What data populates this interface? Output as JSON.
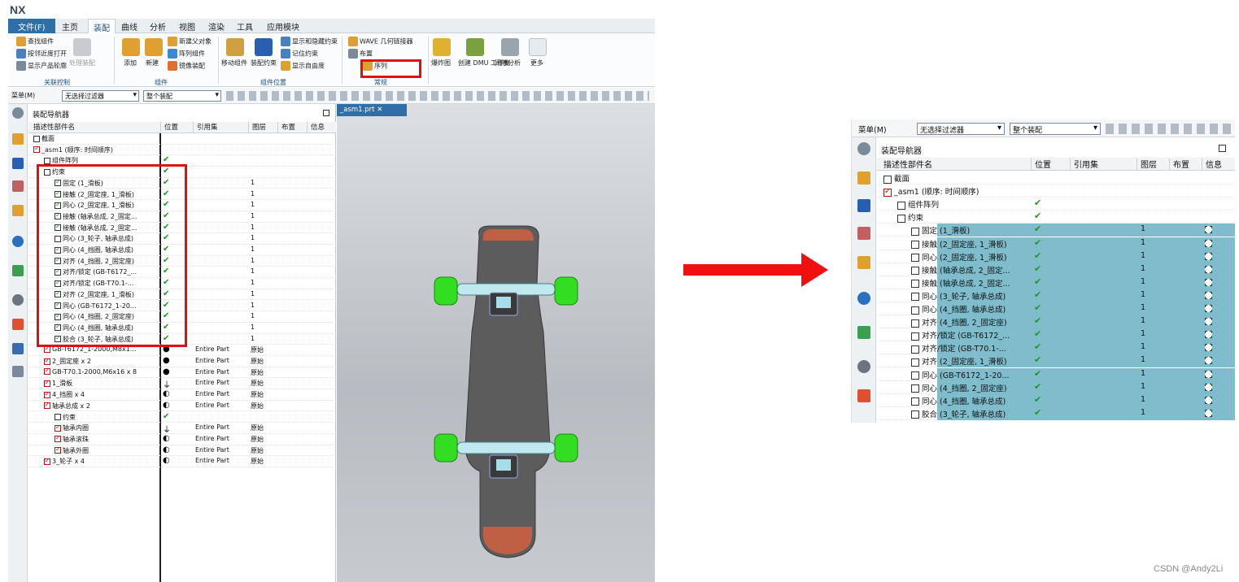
{
  "app": {
    "logo": "NX",
    "file_tab": "文件(F)"
  },
  "menu_tabs": [
    "主页",
    "装配",
    "曲线",
    "分析",
    "视图",
    "渲染",
    "工具",
    "应用模块"
  ],
  "ribbon": {
    "assoc": {
      "find": "查找组件",
      "open_near": "按邻近度打开",
      "show_contour": "显示产品轮廓",
      "process": "处理装配",
      "group": "关联控制"
    },
    "component": {
      "add": "添加",
      "new": "新建",
      "new_parent": "新建父对象",
      "array": "阵列组件",
      "mirror": "镜像装配",
      "group": "组件"
    },
    "position": {
      "move": "移动组件",
      "constraint": "装配约束",
      "show_hide": "显示和隐藏约束",
      "remember": "记住约束",
      "show_dof": "显示自由度",
      "group": "组件位置"
    },
    "general": {
      "wave": "WAVE 几何链接器",
      "layout": "布置",
      "sequence": "序列",
      "group": "常规"
    },
    "more": {
      "explode": "爆炸图",
      "dmu": "创建 DMU 工作集",
      "clearance": "间隙分析",
      "more": "更多"
    }
  },
  "toolbar": {
    "menu": "菜单(M)",
    "filter": "无选择过滤器",
    "scope": "整个装配"
  },
  "navigator": {
    "title": "装配导航器",
    "columns": [
      "描述性部件名",
      "位置",
      "引用集",
      "图层",
      "布置",
      "信息"
    ],
    "rows": [
      {
        "indent": 0,
        "label": "截面",
        "pos": "",
        "ref": "",
        "layer": ""
      },
      {
        "indent": 0,
        "label": "_asm1 (顺序: 时间顺序)",
        "pos": "",
        "ref": "",
        "layer": ""
      },
      {
        "indent": 1,
        "label": "组件阵列",
        "pos": "✔",
        "ref": "",
        "layer": ""
      },
      {
        "indent": 1,
        "label": "约束",
        "pos": "✔",
        "ref": "",
        "layer": ""
      },
      {
        "indent": 2,
        "label": "固定 (1_滑板)",
        "pos": "✔",
        "ref": "",
        "layer": "1"
      },
      {
        "indent": 2,
        "label": "接触 (2_固定座, 1_滑板)",
        "pos": "✔",
        "ref": "",
        "layer": "1"
      },
      {
        "indent": 2,
        "label": "同心 (2_固定座, 1_滑板)",
        "pos": "✔",
        "ref": "",
        "layer": "1"
      },
      {
        "indent": 2,
        "label": "接触 (轴承总成, 2_固定...",
        "pos": "✔",
        "ref": "",
        "layer": "1"
      },
      {
        "indent": 2,
        "label": "接触 (轴承总成, 2_固定...",
        "pos": "✔",
        "ref": "",
        "layer": "1"
      },
      {
        "indent": 2,
        "label": "同心 (3_轮子, 轴承总成)",
        "pos": "✔",
        "ref": "",
        "layer": "1"
      },
      {
        "indent": 2,
        "label": "同心 (4_挡圈, 轴承总成)",
        "pos": "✔",
        "ref": "",
        "layer": "1"
      },
      {
        "indent": 2,
        "label": "对齐 (4_挡圈, 2_固定座)",
        "pos": "✔",
        "ref": "",
        "layer": "1"
      },
      {
        "indent": 2,
        "label": "对齐/锁定 (GB-T6172_...",
        "pos": "✔",
        "ref": "",
        "layer": "1"
      },
      {
        "indent": 2,
        "label": "对齐/锁定 (GB-T70.1-...",
        "pos": "✔",
        "ref": "",
        "layer": "1"
      },
      {
        "indent": 2,
        "label": "对齐 (2_固定座, 1_滑板)",
        "pos": "✔",
        "ref": "",
        "layer": "1"
      },
      {
        "indent": 2,
        "label": "同心 (GB-T6172_1-20...",
        "pos": "✔",
        "ref": "",
        "layer": "1"
      },
      {
        "indent": 2,
        "label": "同心 (4_挡圈, 2_固定座)",
        "pos": "✔",
        "ref": "",
        "layer": "1"
      },
      {
        "indent": 2,
        "label": "同心 (4_挡圈, 轴承总成)",
        "pos": "✔",
        "ref": "",
        "layer": "1"
      },
      {
        "indent": 2,
        "label": "胶合 (3_轮子, 轴承总成)",
        "pos": "✔",
        "ref": "",
        "layer": "1"
      },
      {
        "indent": 1,
        "label": "GB-T6172_1-2000,M8x1...",
        "pos": "●",
        "ref": "Entire Part",
        "layer": "原始"
      },
      {
        "indent": 1,
        "label": "2_固定座 x 2",
        "pos": "●",
        "ref": "Entire Part",
        "layer": "原始"
      },
      {
        "indent": 1,
        "label": "GB-T70.1-2000,M6x16 x 8",
        "pos": "●",
        "ref": "Entire Part",
        "layer": "原始"
      },
      {
        "indent": 1,
        "label": "1_滑板",
        "pos": "⏚",
        "ref": "Entire Part",
        "layer": "原始"
      },
      {
        "indent": 1,
        "label": "4_挡圈 x 4",
        "pos": "◐",
        "ref": "Entire Part",
        "layer": "原始"
      },
      {
        "indent": 1,
        "label": "轴承总成 x 2",
        "pos": "◐",
        "ref": "Entire Part",
        "layer": "原始"
      },
      {
        "indent": 2,
        "label": "约束",
        "pos": "✔",
        "ref": "",
        "layer": ""
      },
      {
        "indent": 2,
        "label": "轴承内圈",
        "pos": "⏚",
        "ref": "Entire Part",
        "layer": "原始"
      },
      {
        "indent": 2,
        "label": "轴承滚珠",
        "pos": "◐",
        "ref": "Entire Part",
        "layer": "原始"
      },
      {
        "indent": 2,
        "label": "轴承外圈",
        "pos": "◐",
        "ref": "Entire Part",
        "layer": "原始"
      },
      {
        "indent": 1,
        "label": "3_轮子 x 4",
        "pos": "◐",
        "ref": "Entire Part",
        "layer": "原始"
      }
    ]
  },
  "viewport": {
    "tab": "_asm1.prt"
  },
  "right": {
    "toolbar": {
      "menu": "菜单(M)",
      "filter": "无选择过滤器",
      "scope": "整个装配"
    },
    "title": "装配导航器",
    "columns": [
      "描述性部件名",
      "位置",
      "引用集",
      "图层",
      "布置",
      "信息"
    ],
    "rows": [
      {
        "indent": 0,
        "label": "截面",
        "pos": "",
        "layer": "",
        "sel": false
      },
      {
        "indent": 0,
        "label": "_asm1 (顺序: 时间顺序)",
        "pos": "",
        "layer": "",
        "sel": false
      },
      {
        "indent": 1,
        "label": "组件阵列",
        "pos": "✔",
        "layer": "",
        "sel": false
      },
      {
        "indent": 1,
        "label": "约束",
        "pos": "✔",
        "layer": "",
        "sel": false
      },
      {
        "indent": 2,
        "label": "固定 (1_滑板)",
        "pos": "✔",
        "layer": "1",
        "sel": true
      },
      {
        "indent": 2,
        "label": "接触 (2_固定座, 1_滑板)",
        "pos": "✔",
        "layer": "1",
        "sel": true
      },
      {
        "indent": 2,
        "label": "同心 (2_固定座, 1_滑板)",
        "pos": "✔",
        "layer": "1",
        "sel": true
      },
      {
        "indent": 2,
        "label": "接触 (轴承总成, 2_固定...",
        "pos": "✔",
        "layer": "1",
        "sel": true
      },
      {
        "indent": 2,
        "label": "接触 (轴承总成, 2_固定...",
        "pos": "✔",
        "layer": "1",
        "sel": true
      },
      {
        "indent": 2,
        "label": "同心 (3_轮子, 轴承总成)",
        "pos": "✔",
        "layer": "1",
        "sel": true
      },
      {
        "indent": 2,
        "label": "同心 (4_挡圈, 轴承总成)",
        "pos": "✔",
        "layer": "1",
        "sel": true
      },
      {
        "indent": 2,
        "label": "对齐 (4_挡圈, 2_固定座)",
        "pos": "✔",
        "layer": "1",
        "sel": true
      },
      {
        "indent": 2,
        "label": "对齐/锁定 (GB-T6172_...",
        "pos": "✔",
        "layer": "1",
        "sel": true
      },
      {
        "indent": 2,
        "label": "对齐/锁定 (GB-T70.1-...",
        "pos": "✔",
        "layer": "1",
        "sel": true
      },
      {
        "indent": 2,
        "label": "对齐 (2_固定座, 1_滑板)",
        "pos": "✔",
        "layer": "1",
        "sel": true
      },
      {
        "indent": 2,
        "label": "同心 (GB-T6172_1-20...",
        "pos": "✔",
        "layer": "1",
        "sel": true
      },
      {
        "indent": 2,
        "label": "同心 (4_挡圈, 2_固定座)",
        "pos": "✔",
        "layer": "1",
        "sel": true
      },
      {
        "indent": 2,
        "label": "同心 (4_挡圈, 轴承总成)",
        "pos": "✔",
        "layer": "1",
        "sel": true
      },
      {
        "indent": 2,
        "label": "胶合 (3_轮子, 轴承总成)",
        "pos": "✔",
        "layer": "1",
        "sel": true
      }
    ]
  },
  "watermark": "CSDN @Andy2Li",
  "colors": {
    "accent": "#2f6fa8",
    "highlight": "#7fbccc",
    "annotation": "#e01010",
    "wheel": "#33dd22",
    "board": "#5c5c5c"
  }
}
